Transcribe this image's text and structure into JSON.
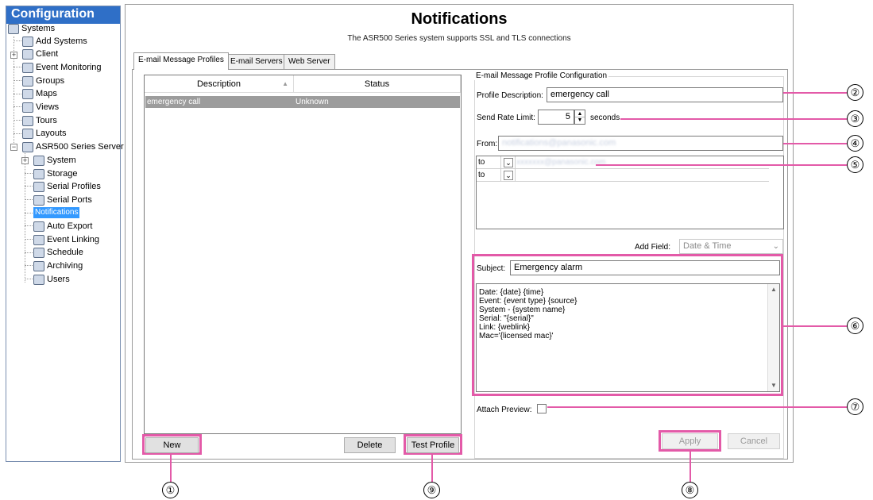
{
  "sidebar": {
    "title": "Configuration",
    "items": [
      {
        "label": "Systems",
        "icon": "systems-icon"
      },
      {
        "label": "Add Systems",
        "icon": "add-systems-icon"
      },
      {
        "label": "Client",
        "icon": "client-icon"
      },
      {
        "label": "Event Monitoring",
        "icon": "event-monitoring-icon"
      },
      {
        "label": "Groups",
        "icon": "groups-icon"
      },
      {
        "label": "Maps",
        "icon": "maps-icon"
      },
      {
        "label": "Views",
        "icon": "views-icon"
      },
      {
        "label": "Tours",
        "icon": "tours-icon"
      },
      {
        "label": "Layouts",
        "icon": "layouts-icon"
      },
      {
        "label": "ASR500 Series Server",
        "icon": "server-icon"
      },
      {
        "label": "System",
        "icon": "system-icon"
      },
      {
        "label": "Storage",
        "icon": "storage-icon"
      },
      {
        "label": "Serial Profiles",
        "icon": "serial-profiles-icon"
      },
      {
        "label": "Serial Ports",
        "icon": "serial-ports-icon"
      },
      {
        "label": "Notifications",
        "icon": "notifications-icon"
      },
      {
        "label": "Auto Export",
        "icon": "auto-export-icon"
      },
      {
        "label": "Event Linking",
        "icon": "event-linking-icon"
      },
      {
        "label": "Schedule",
        "icon": "schedule-icon"
      },
      {
        "label": "Archiving",
        "icon": "archiving-icon"
      },
      {
        "label": "Users",
        "icon": "users-icon"
      }
    ]
  },
  "main": {
    "title": "Notifications",
    "subtitle": "The ASR500 Series system supports SSL and TLS connections",
    "tabs": [
      "E-mail Message Profiles",
      "E-mail Servers",
      "Web Server"
    ],
    "list": {
      "columns": [
        "Description",
        "Status"
      ],
      "rows": [
        {
          "description": "emergency call",
          "status": "Unknown"
        }
      ]
    },
    "buttons": {
      "new": "New",
      "delete": "Delete",
      "test_profile": "Test Profile",
      "apply": "Apply",
      "cancel": "Cancel"
    },
    "config": {
      "group_title": "E-mail Message Profile Configuration",
      "profile_description_label": "Profile Description:",
      "profile_description_value": "emergency call",
      "send_rate_label": "Send Rate Limit:",
      "send_rate_value": "5",
      "send_rate_unit": "seconds",
      "from_label": "From:",
      "from_value": "notifications@panasonic.com",
      "recipients": [
        {
          "type": "to",
          "address": "xxxxxxx@panasonic.com"
        },
        {
          "type": "to",
          "address": ""
        }
      ],
      "add_field_label": "Add Field:",
      "add_field_value": "Date & Time",
      "subject_label": "Subject:",
      "subject_value": "Emergency alarm",
      "body_lines": [
        "Date: {date} {time}",
        "Event: {event type} {source}",
        "System - {system name}",
        "Serial: \"{serial}\"",
        "Link: {weblink}",
        "Mac='{licensed mac}'"
      ],
      "attach_preview_label": "Attach Preview:"
    }
  },
  "callouts": [
    "①",
    "②",
    "③",
    "④",
    "⑤",
    "⑥",
    "⑦",
    "⑧",
    "⑨"
  ],
  "colors": {
    "accent": "#2f6fc7",
    "selection": "#3399ff",
    "callout": "#e35aa8"
  }
}
